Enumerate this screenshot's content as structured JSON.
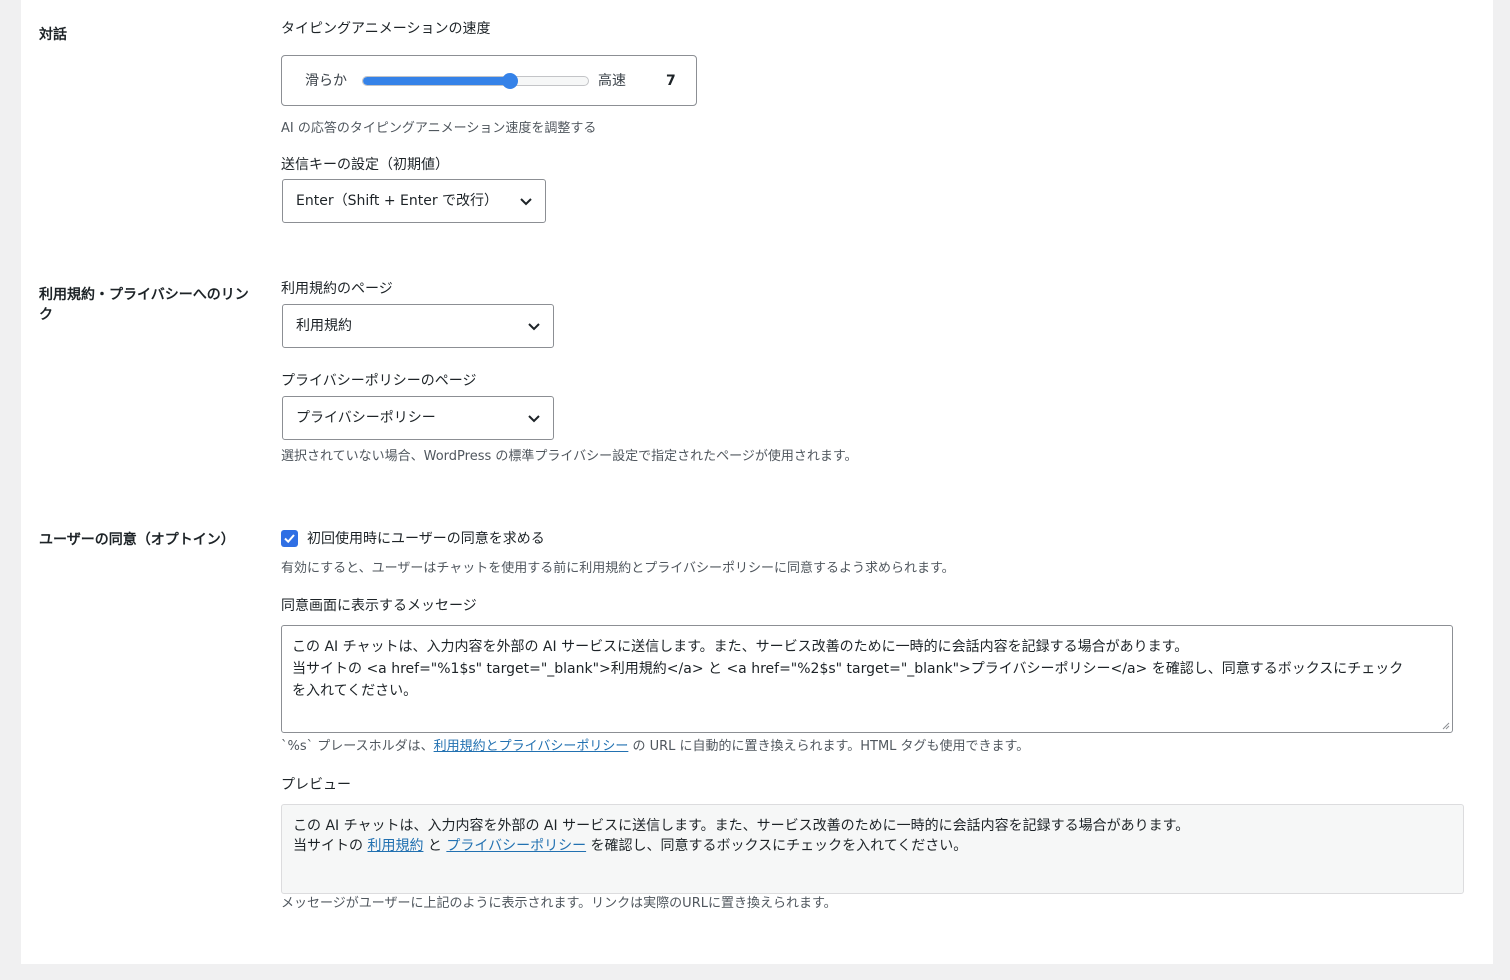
{
  "sections": {
    "dialog": {
      "title": "対話",
      "typing_speed_label": "タイピングアニメーションの速度",
      "slider": {
        "min_label": "滑らか",
        "max_label": "高速",
        "value": "7",
        "fraction": 0.65
      },
      "typing_speed_desc": "AI の応答のタイピングアニメーション速度を調整する",
      "send_key_label": "送信キーの設定（初期値）",
      "send_key_value": "Enter（Shift + Enter で改行）"
    },
    "links": {
      "title": "利用規約・プライバシーへのリンク",
      "terms_label": "利用規約のページ",
      "terms_value": "利用規約",
      "privacy_label": "プライバシーポリシーのページ",
      "privacy_value": "プライバシーポリシー",
      "desc": "選択されていない場合、WordPress の標準プライバシー設定で指定されたページが使用されます。"
    },
    "consent": {
      "title": "ユーザーの同意（オプトイン）",
      "checkbox_label": "初回使用時にユーザーの同意を求める",
      "checkbox_checked": true,
      "checkbox_desc": "有効にすると、ユーザーはチャットを使用する前に利用規約とプライバシーポリシーに同意するよう求められます。",
      "message_label": "同意画面に表示するメッセージ",
      "message_lines": [
        "この AI チャットは、入力内容を外部の AI サービスに送信します。また、サービス改善のために一時的に会話内容を記録する場合があります。",
        "当サイトの <a href=\"%1$s\" target=\"_blank\">利用規約</a> と <a href=\"%2$s\" target=\"_blank\">プライバシーポリシー</a> を確認し、同意するボックスにチェック",
        "を入れてください。"
      ],
      "placeholder_desc_prefix": "`%s` プレースホルダは、",
      "placeholder_desc_link": "利用規約とプライバシーポリシー",
      "placeholder_desc_suffix": " の URL に自動的に置き換えられます。HTML タグも使用できます。",
      "preview_label": "プレビュー",
      "preview_line1": "この AI チャットは、入力内容を外部の AI サービスに送信します。また、サービス改善のために一時的に会話内容を記録する場合があります。",
      "preview_line2_prefix": "当サイトの ",
      "preview_terms_link": "利用規約",
      "preview_and": " と ",
      "preview_privacy_link": "プライバシーポリシー",
      "preview_line2_suffix": " を確認し、同意するボックスにチェックを入れてください。",
      "preview_desc": "メッセージがユーザーに上記のように表示されます。リンクは実際のURLに置き換えられます。"
    }
  },
  "colors": {
    "accent": "#3582e8",
    "link": "#2271b1",
    "checkbox": "#2f6fe4"
  }
}
